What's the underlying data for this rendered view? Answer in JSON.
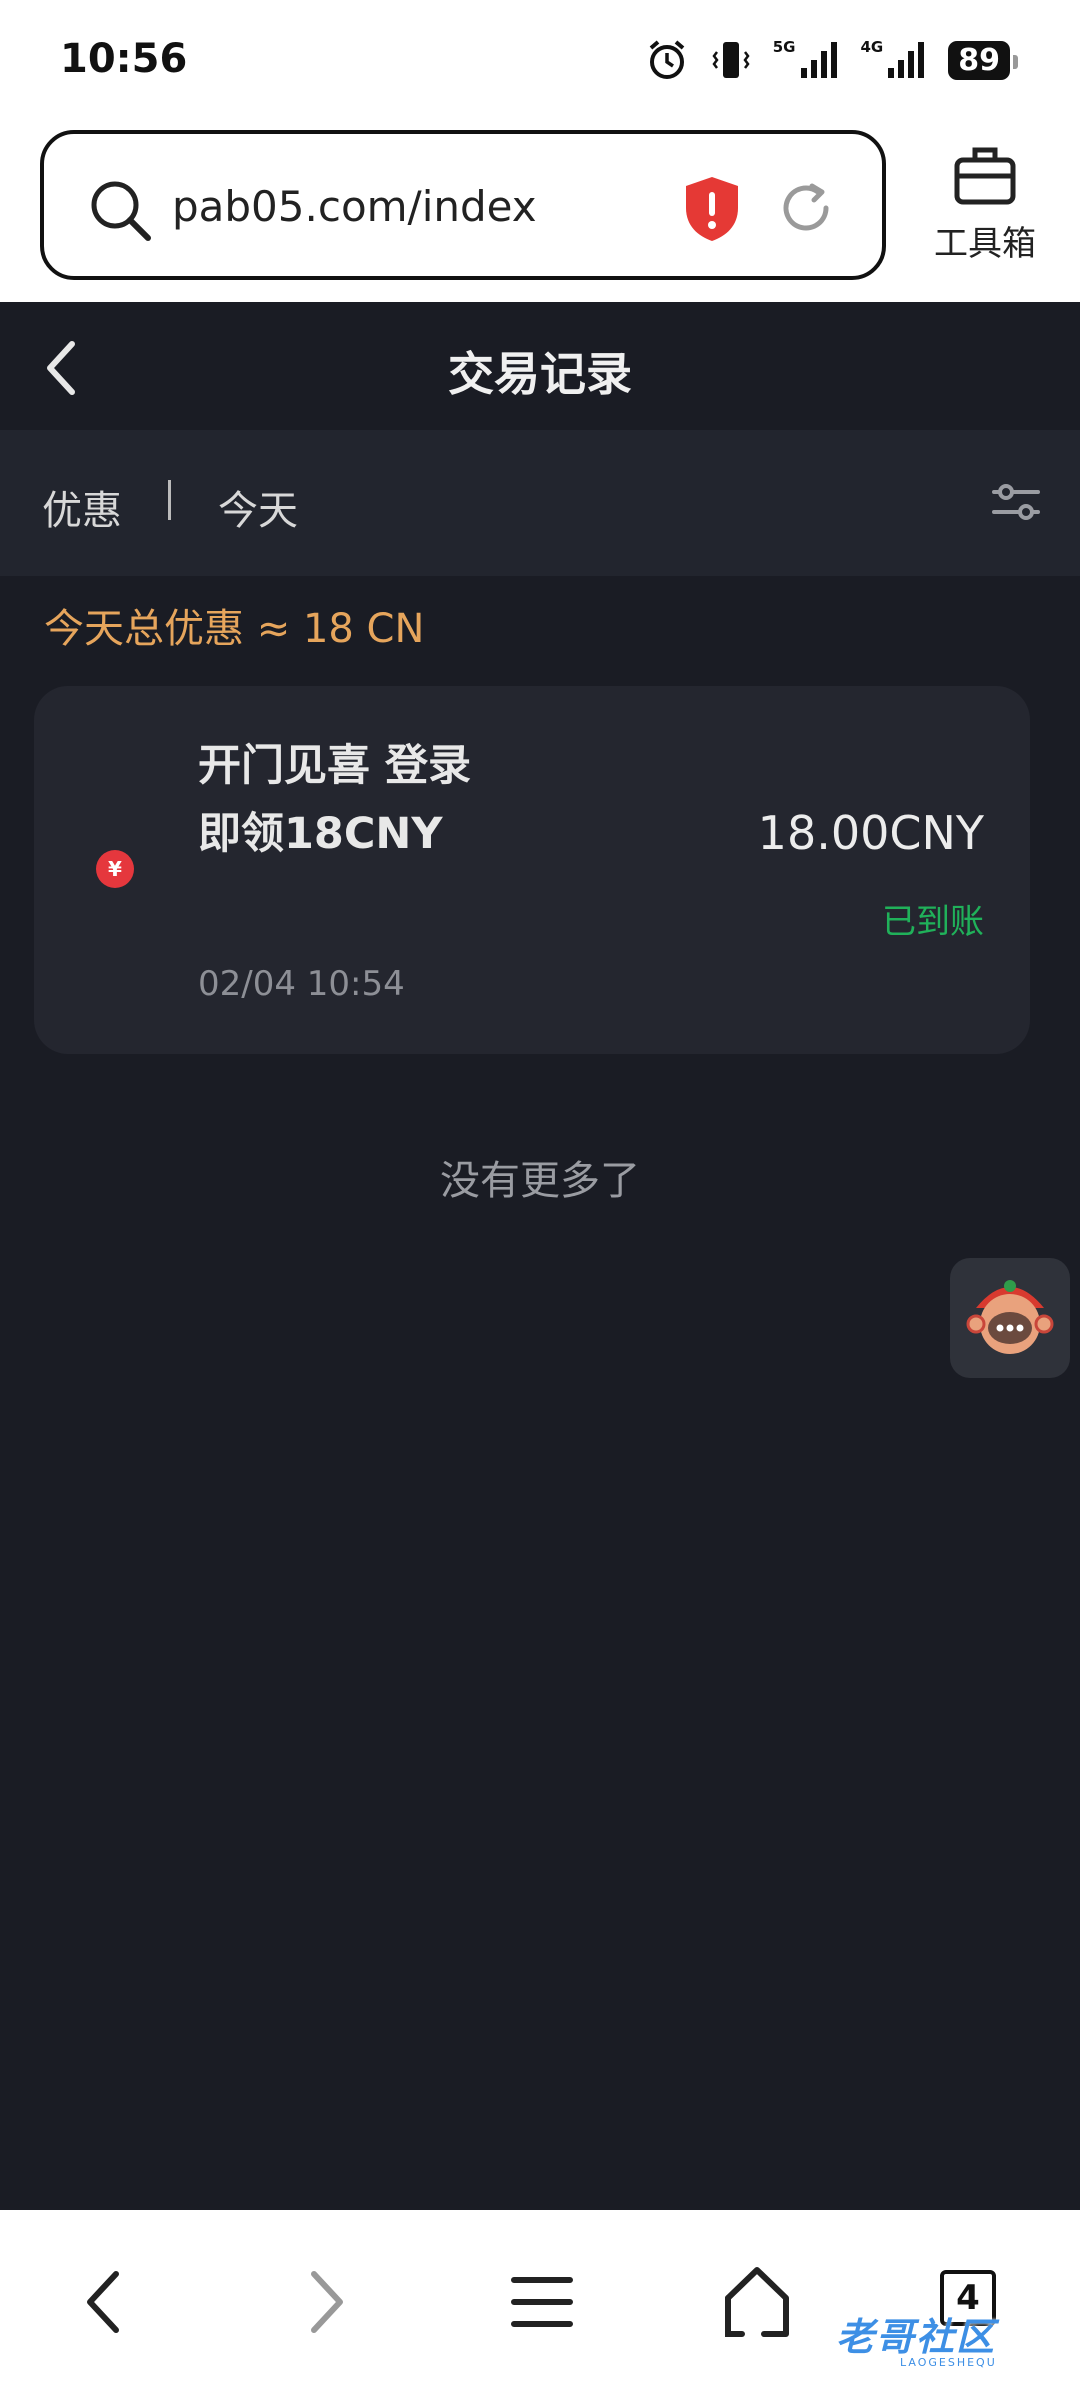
{
  "status_bar": {
    "time": "10:56",
    "network_1": "5G",
    "network_2": "4G",
    "battery": "89"
  },
  "browser": {
    "url": "pab05.com/index",
    "toolbox_label": "工具箱"
  },
  "page": {
    "title": "交易记录"
  },
  "filter": {
    "type": "优惠",
    "date": "今天"
  },
  "summary": "今天总优惠 ≈ 18 CN",
  "records": [
    {
      "title": "开门见喜 登录即领18CNY",
      "time": "02/04 10:54",
      "amount": "18.00CNY",
      "status": "已到账",
      "currency_symbol": "¥"
    }
  ],
  "list_end_text": "没有更多了",
  "bottom_nav": {
    "tab_count": "4",
    "watermark": "老哥社区",
    "watermark_sub": "LAOGESHEQU"
  },
  "colors": {
    "page_bg": "#1a1c24",
    "card_bg": "#24262f",
    "summary": "#e6a55c",
    "status_ok": "#20b15a",
    "yen_badge": "#e5373d",
    "shield": "#e53935"
  }
}
